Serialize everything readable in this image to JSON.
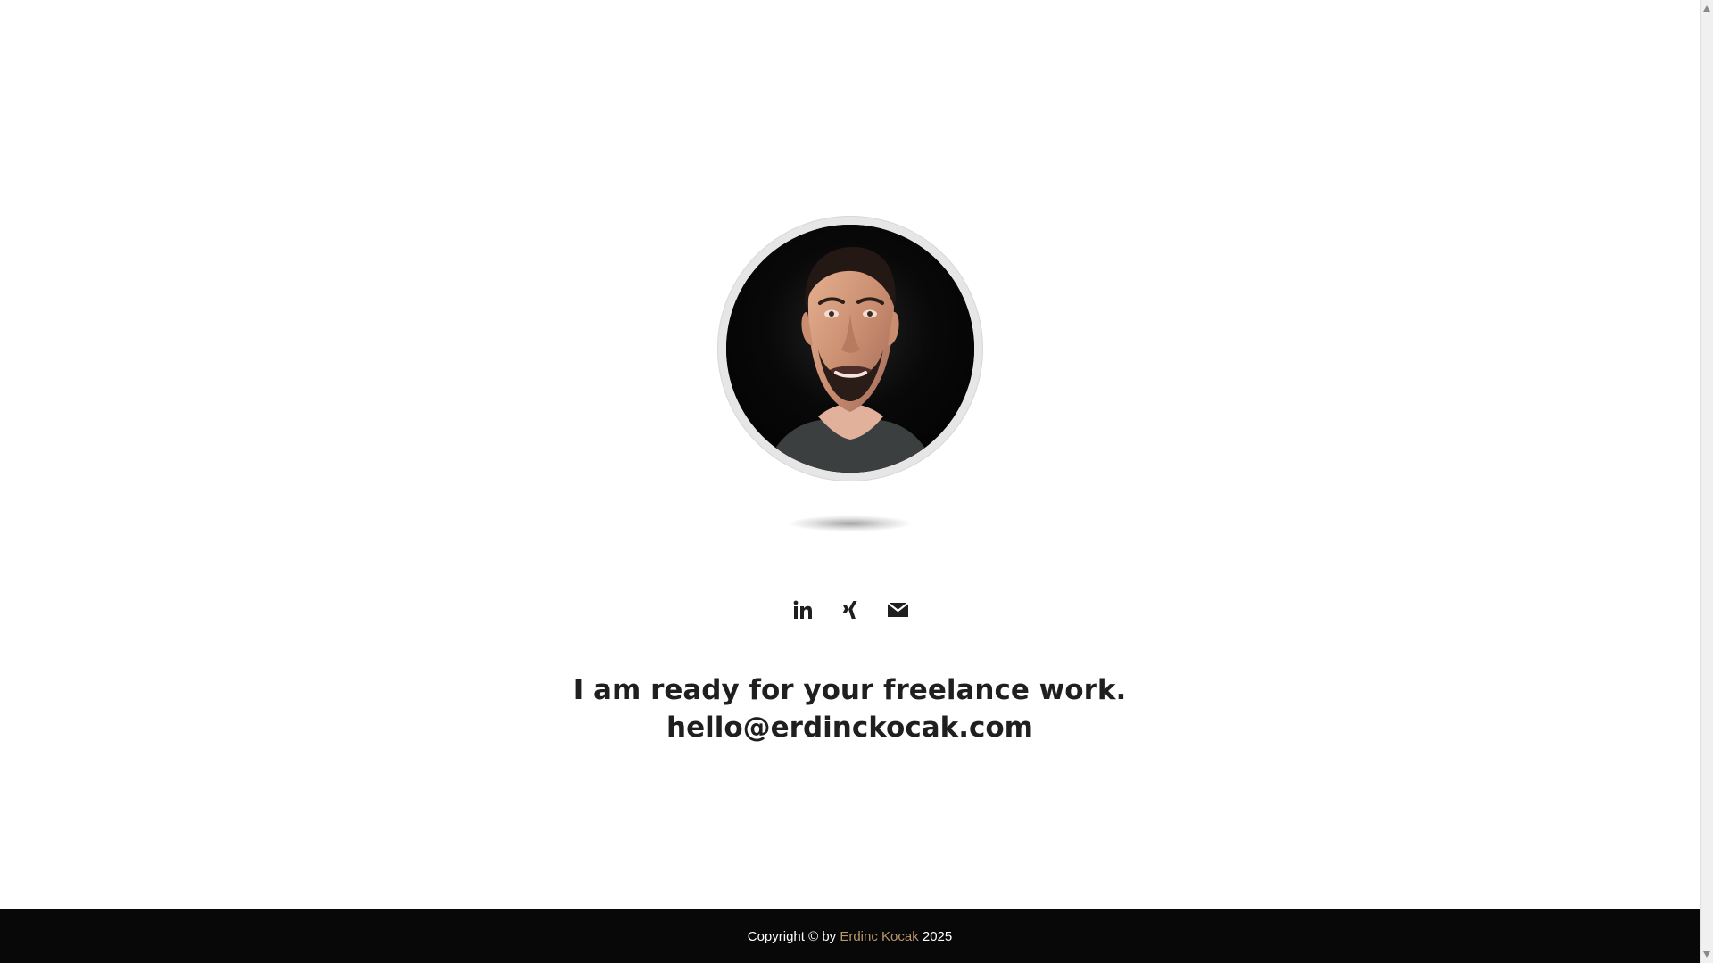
{
  "profile": {
    "photo_alt": "Portrait photo"
  },
  "social": {
    "items": [
      {
        "icon": "linkedin-icon"
      },
      {
        "icon": "xing-icon"
      },
      {
        "icon": "envelope-icon"
      }
    ]
  },
  "main": {
    "headline_line1": "I am ready for your freelance work.",
    "headline_line2": "hello@erdinckocak.com"
  },
  "footer": {
    "copyright_prefix": "Copyright © by ",
    "author_name": "Erdinc Kocak",
    "copyright_suffix": " 2025",
    "accent_color": "#b8966b",
    "background_color": "#080808"
  }
}
